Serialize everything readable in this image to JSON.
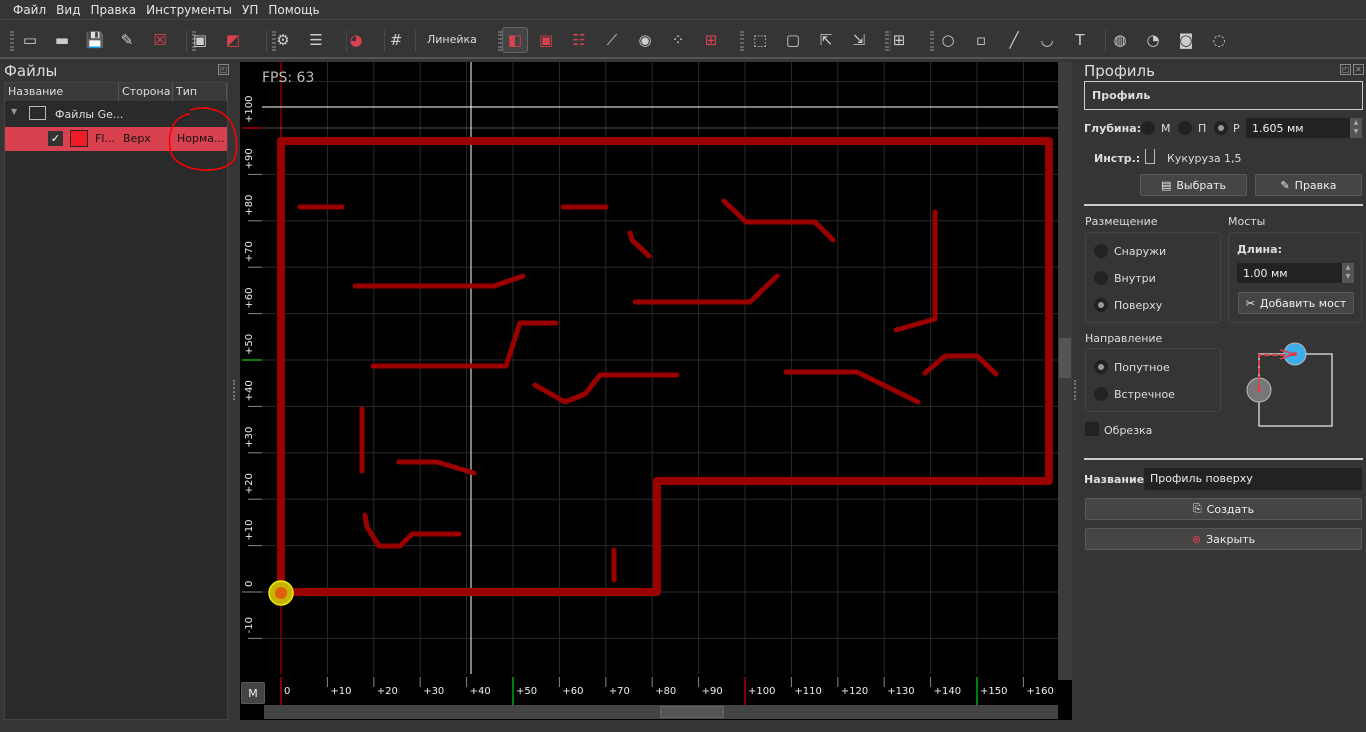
{
  "menu": [
    "Файл",
    "Вид",
    "Правка",
    "Инструменты",
    "УП",
    "Помощь"
  ],
  "toolbar": {
    "ruler_label": "Линейка",
    "icons": [
      "new-file-icon",
      "open-folder-icon",
      "save-icon",
      "save-as-icon",
      "close-file-icon",
      "save-all-icon",
      "export-icon",
      "run-icon",
      "properties-icon",
      "origin-icon",
      "snap-grid-icon",
      "profile-icon",
      "pocket-spiral-icon",
      "pocket-zigzag-icon",
      "trace-icon",
      "drill-icon",
      "drill-array-icon",
      "drill-matrix-icon",
      "fit-selection-icon",
      "fit-all-icon",
      "zoom-in-icon",
      "zoom-out-icon",
      "select-all-icon",
      "circle-icon",
      "rectangle-icon",
      "line-icon",
      "arc-icon",
      "text-icon",
      "union-icon",
      "subtract-icon",
      "intersect-icon",
      "xor-icon"
    ]
  },
  "files": {
    "title": "Файлы",
    "columns": [
      "Название",
      "Сторона",
      "Тип"
    ],
    "group": "Файлы Ge...",
    "item": {
      "name": "Fl...",
      "side": "Верх",
      "type": "Норма...",
      "checked": true,
      "color": "#ee1c24"
    }
  },
  "canvas": {
    "fps": "FPS: 63",
    "mode_button": "M",
    "x_ticks": [
      "0",
      "+10",
      "+20",
      "+30",
      "+40",
      "+50",
      "+60",
      "+70",
      "+80",
      "+90",
      "+100",
      "+110",
      "+120",
      "+130",
      "+140",
      "+150",
      "+160"
    ],
    "y_ticks": [
      "-10",
      "0",
      "+10",
      "+20",
      "+30",
      "+40",
      "+50",
      "+60",
      "+70",
      "+80",
      "+90",
      "+100"
    ],
    "trace_color": "#9b0000"
  },
  "profile": {
    "title": "Профиль",
    "name_box": "Профиль",
    "depth_label": "Глубина:",
    "depth_options": [
      "М",
      "П",
      "Р"
    ],
    "depth_selected": "Р",
    "depth_value": "1.605 мм",
    "tool_label": "Инстр.:",
    "tool_value": "Кукуруза 1,5",
    "select_button": "Выбрать",
    "edit_button": "Правка",
    "placement_label": "Размещение",
    "placement_options": [
      "Снаружи",
      "Внутри",
      "Поверху"
    ],
    "placement_selected": "Поверху",
    "bridges_label": "Мосты",
    "length_label": "Длина:",
    "length_value": "1.00 мм",
    "add_bridge_button": "Добавить мост",
    "direction_label": "Направление",
    "direction_options": [
      "Попутное",
      "Встречное"
    ],
    "direction_selected": "Попутное",
    "trim_label": "Обрезка",
    "trim_checked": false,
    "name_label": "Название:",
    "name_value": "Профиль поверху",
    "create_button": "Создать",
    "close_button": "Закрыть"
  }
}
